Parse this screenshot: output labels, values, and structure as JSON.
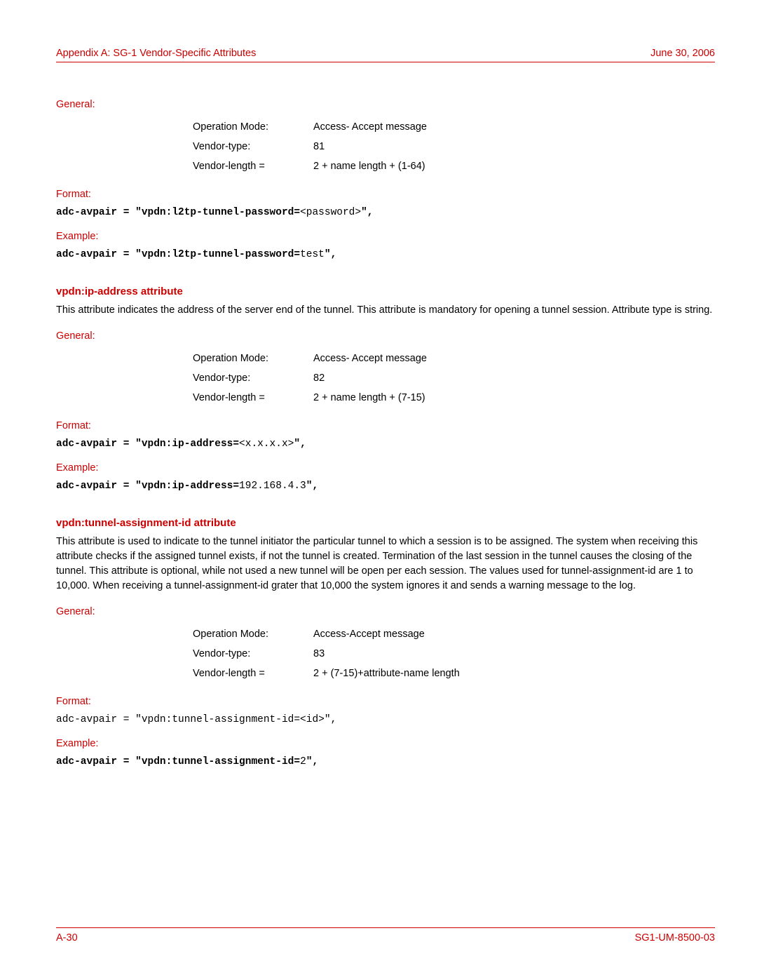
{
  "header": {
    "left": "Appendix A: SG-1 Vendor-Specific Attributes",
    "right": "June 30, 2006"
  },
  "sec1": {
    "general_label": "General:",
    "rows": {
      "r1k": "Operation Mode:",
      "r1v": "Access- Accept message",
      "r2k": "Vendor-type:",
      "r2v": "81",
      "r3k": "Vendor-length =",
      "r3v": "2 + name length + (1-64)"
    },
    "format_label": "Format:",
    "format_code_b": "adc-avpair = \"vpdn:l2tp-tunnel-password=",
    "format_code_p": "<password>",
    "format_code_e": "\",",
    "example_label": "Example:",
    "example_code_b": "adc-avpair = \"vpdn:l2tp-tunnel-password=",
    "example_code_p": "test",
    "example_code_e": "\","
  },
  "sec2": {
    "title": "vpdn:ip-address attribute",
    "desc": "This attribute indicates the address of the server end of the tunnel. This attribute is mandatory for opening a tunnel session. Attribute type is string.",
    "general_label": "General:",
    "rows": {
      "r1k": "Operation Mode:",
      "r1v": "Access- Accept message",
      "r2k": "Vendor-type:",
      "r2v": "82",
      "r3k": "Vendor-length =",
      "r3v": "2 + name length + (7-15)"
    },
    "format_label": "Format:",
    "format_code_b": "adc-avpair = \"vpdn:ip-address=",
    "format_code_p": "<x.x.x.x>",
    "format_code_e": "\",",
    "example_label": "Example:",
    "example_code_b": "adc-avpair = \"vpdn:ip-address=",
    "example_code_p": "192.168.4.3",
    "example_code_e": "\","
  },
  "sec3": {
    "title": "vpdn:tunnel-assignment-id attribute",
    "desc": "This attribute is used to indicate to the tunnel initiator the particular tunnel to which a session is to be assigned. The system when receiving this attribute checks if the assigned tunnel exists, if not the tunnel is created. Termination of the last session in the tunnel causes the closing of the tunnel. This attribute is optional, while not used a new tunnel will be open per each session. The values used for tunnel-assignment-id are 1 to 10,000. When receiving a tunnel-assignment-id grater that 10,000 the system ignores it and sends a warning message to the log.",
    "general_label": "General:",
    "rows": {
      "r1k": "Operation Mode:",
      "r1v": "Access-Accept message",
      "r2k": "Vendor-type:",
      "r2v": "83",
      "r3k": "Vendor-length =",
      "r3v": "2 + (7-15)+attribute-name length"
    },
    "format_label": "Format:",
    "format_code": "adc-avpair = \"vpdn:tunnel-assignment-id=<id>\",",
    "example_label": "Example:",
    "example_code_b": "adc-avpair = \"vpdn:tunnel-assignment-id=",
    "example_code_p": "2",
    "example_code_e": "\","
  },
  "footer": {
    "left": "A-30",
    "right": "SG1-UM-8500-03"
  }
}
